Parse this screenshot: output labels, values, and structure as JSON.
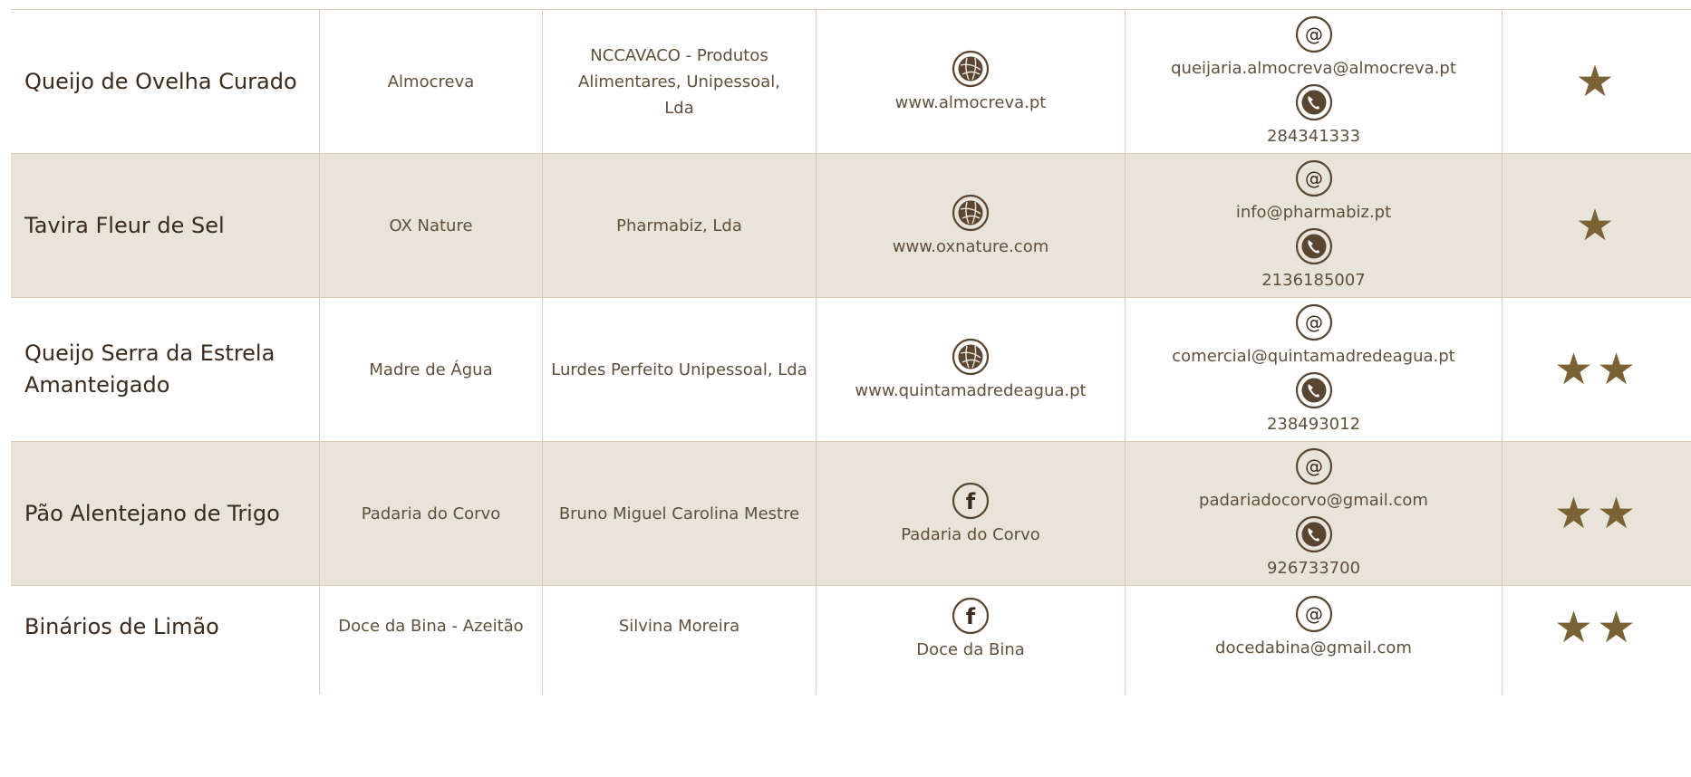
{
  "rows": [
    {
      "product": "Queijo de Ovelha Curado",
      "brand": "Almocreva",
      "company": "NCCAVACO - Produtos Alimentares, Unipessoal, Lda",
      "web_icon": "globe-icon",
      "web": "www.almocreva.pt",
      "email": "queijaria.almocreva@almocreva.pt",
      "phone": "284341333",
      "stars": "★"
    },
    {
      "product": "Tavira Fleur de Sel",
      "brand": "OX Nature",
      "company": "Pharmabiz, Lda",
      "web_icon": "globe-icon",
      "web": "www.oxnature.com",
      "email": "info@pharmabiz.pt",
      "phone": "2136185007",
      "stars": "★"
    },
    {
      "product": "Queijo Serra da Estrela Amanteigado",
      "brand": "Madre de Água",
      "company": "Lurdes Perfeito Unipessoal, Lda",
      "web_icon": "globe-icon",
      "web": "www.quintamadredeagua.pt",
      "email": "comercial@quintamadredeagua.pt",
      "phone": "238493012",
      "stars": "★★"
    },
    {
      "product": "Pão Alentejano de Trigo",
      "brand": "Padaria do Corvo",
      "company": "Bruno Miguel Carolina Mestre",
      "web_icon": "facebook-icon",
      "web": "Padaria do Corvo",
      "email": "padariadocorvo@gmail.com",
      "phone": "926733700",
      "stars": "★★"
    },
    {
      "product": "Binários de Limão",
      "brand": "Doce da Bina - Azeitão",
      "company": "Silvina Moreira",
      "web_icon": "facebook-icon",
      "web": "Doce da Bina",
      "email": "docedabina@gmail.com",
      "phone": "",
      "stars": "★★"
    }
  ],
  "colors": {
    "accent": "#7a6235",
    "shade": "#e9e4da",
    "border": "#d9cdb8",
    "text": "#5f4f3b"
  }
}
